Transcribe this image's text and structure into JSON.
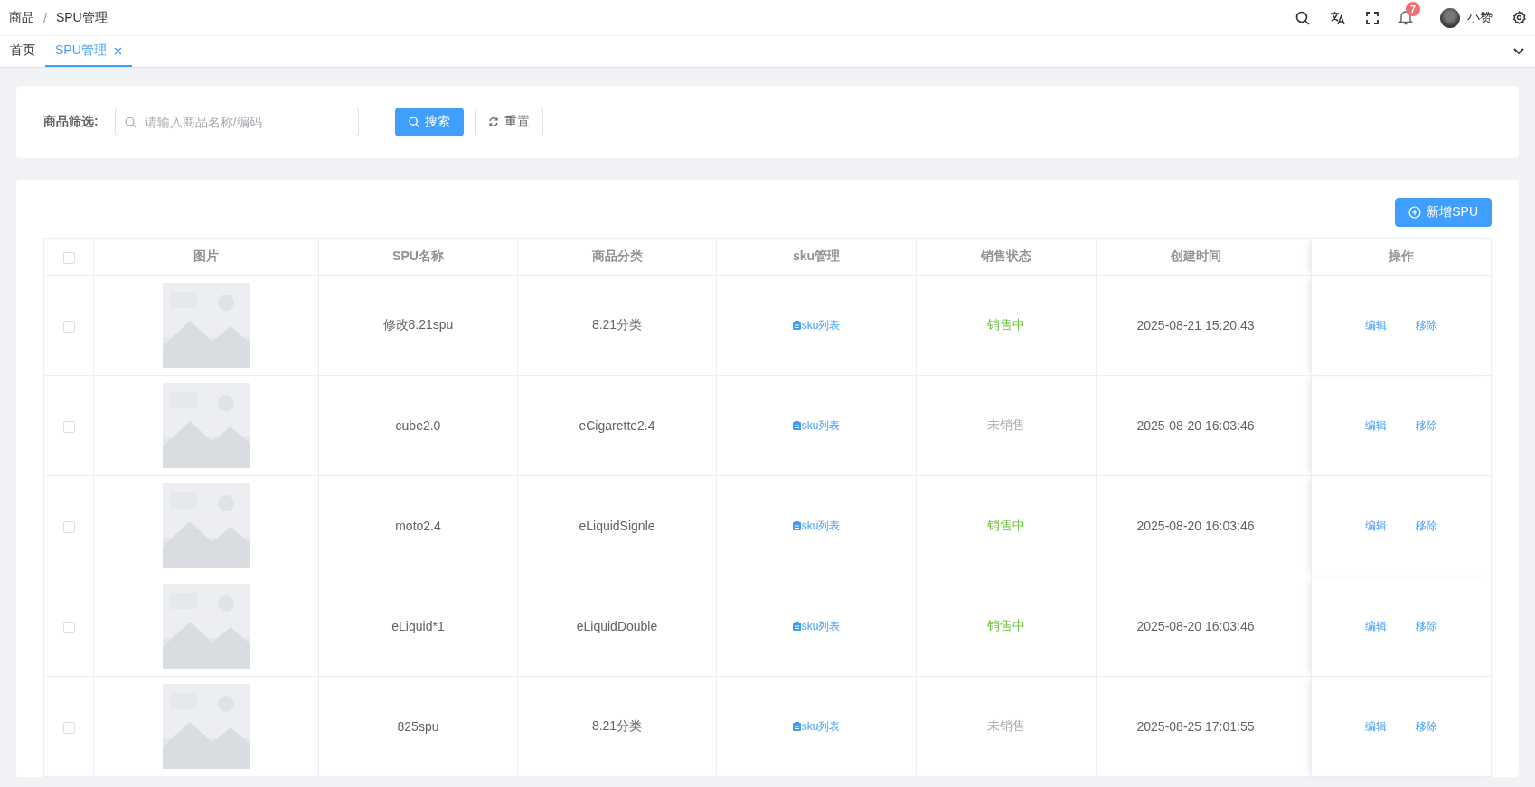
{
  "breadcrumb": [
    "商品",
    "SPU管理"
  ],
  "breadcrumb_separator": "/",
  "header": {
    "notification_count": "7",
    "user_name": "小赞"
  },
  "tabs": [
    {
      "label": "首页",
      "selected": false,
      "closable": false
    },
    {
      "label": "SPU管理",
      "selected": true,
      "closable": true
    }
  ],
  "filter": {
    "label": "商品筛选:",
    "placeholder": "请输入商品名称/编码",
    "search_button": "搜索",
    "reset_button": "重置"
  },
  "add_button": "新增SPU",
  "table": {
    "all_checked": false,
    "columns": [
      "图片",
      "SPU名称",
      "商品分类",
      "sku管理",
      "销售状态",
      "创建时间",
      "操作"
    ],
    "rows": [
      {
        "checked": false,
        "name": "修改8.21spu",
        "category": "8.21分类",
        "sku_link": "sku列表",
        "status": "销售中",
        "on_sale": true,
        "created": "2025-08-21 15:20:43",
        "actions": [
          "编辑",
          "移除"
        ]
      },
      {
        "checked": false,
        "name": "cube2.0",
        "category": "eCigarette2.4",
        "sku_link": "sku列表",
        "status": "未销售",
        "on_sale": false,
        "created": "2025-08-20 16:03:46",
        "actions": [
          "编辑",
          "移除"
        ]
      },
      {
        "checked": false,
        "name": "moto2.4",
        "category": "eLiquidSignle",
        "sku_link": "sku列表",
        "status": "销售中",
        "on_sale": true,
        "created": "2025-08-20 16:03:46",
        "actions": [
          "编辑",
          "移除"
        ]
      },
      {
        "checked": false,
        "name": "eLiquid*1",
        "category": "eLiquidDouble",
        "sku_link": "sku列表",
        "status": "销售中",
        "on_sale": true,
        "created": "2025-08-20 16:03:46",
        "actions": [
          "编辑",
          "移除"
        ]
      },
      {
        "checked": false,
        "name": "825spu",
        "category": "8.21分类",
        "sku_link": "sku列表",
        "status": "未销售",
        "on_sale": false,
        "created": "2025-08-25 17:01:55",
        "actions": [
          "编辑",
          "移除"
        ]
      }
    ]
  }
}
